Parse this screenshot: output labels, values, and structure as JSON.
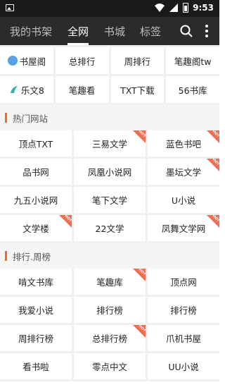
{
  "status": {
    "time": "9:53"
  },
  "nav": {
    "tabs": [
      {
        "label": "我的书架"
      },
      {
        "label": "全网"
      },
      {
        "label": "书城"
      },
      {
        "label": "标签"
      }
    ]
  },
  "quick": [
    {
      "label": "书屋阁"
    },
    {
      "label": "总排行"
    },
    {
      "label": "周排行"
    },
    {
      "label": "笔趣阁tw"
    },
    {
      "label": "乐文8"
    },
    {
      "label": "笔趣看"
    },
    {
      "label": "TXT下载"
    },
    {
      "label": "56书库"
    }
  ],
  "sections": [
    {
      "title": "热门网站",
      "items": [
        {
          "label": "顶点TXT",
          "hot": false
        },
        {
          "label": "三易文学",
          "hot": true
        },
        {
          "label": "蓝色书吧",
          "hot": true
        },
        {
          "label": "品书网",
          "hot": false
        },
        {
          "label": "凤凰小说网",
          "hot": false
        },
        {
          "label": "墨坛文学",
          "hot": true
        },
        {
          "label": "九五小说网",
          "hot": false
        },
        {
          "label": "笔下文学",
          "hot": false
        },
        {
          "label": "U小说",
          "hot": false
        },
        {
          "label": "文学楼",
          "hot": true
        },
        {
          "label": "22文学",
          "hot": false
        },
        {
          "label": "凤舞文学网",
          "hot": true
        }
      ]
    },
    {
      "title": "排行.周榜",
      "items": [
        {
          "label": "啃文书库",
          "hot": false
        },
        {
          "label": "笔趣库",
          "hot": true
        },
        {
          "label": "顶点网",
          "hot": false
        },
        {
          "label": "我爱小说",
          "hot": false
        },
        {
          "label": "排行榜",
          "hot": false
        },
        {
          "label": "排行榜",
          "hot": false
        },
        {
          "label": "周排行榜",
          "hot": false
        },
        {
          "label": "总排行榜",
          "hot": true
        },
        {
          "label": "爪机书屋",
          "hot": false
        },
        {
          "label": "看书啦",
          "hot": false
        },
        {
          "label": "零点中文",
          "hot": false
        },
        {
          "label": "UU小说",
          "hot": false
        }
      ]
    }
  ],
  "badge": {
    "hot_text": "HOT"
  },
  "colors": {
    "accent": "#ef6a2a",
    "hot": "#f26c4f",
    "topbar": "#2b2b2b"
  }
}
